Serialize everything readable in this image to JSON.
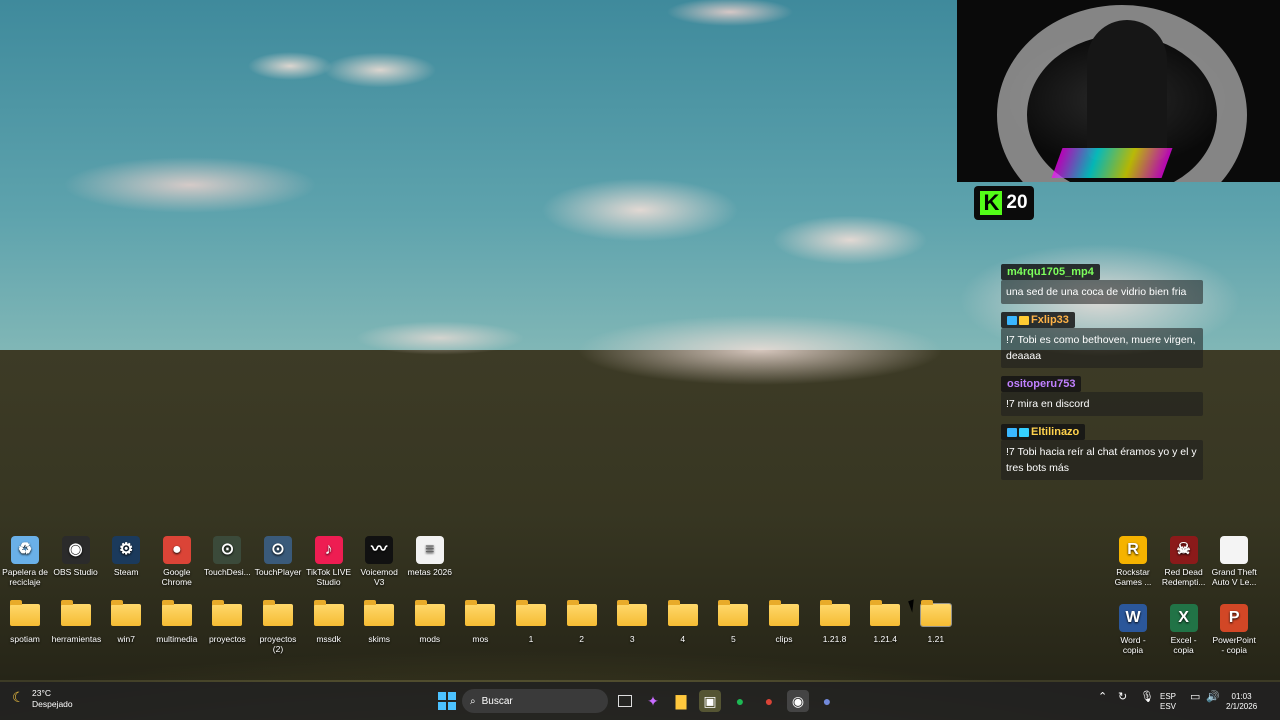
{
  "kick": {
    "count": "20",
    "logo": "K"
  },
  "chat": [
    {
      "user": "m4rqu1705_mp4",
      "user_color": "#7dff5c",
      "badges": [],
      "text": "una sed de una coca de vidrio bien fria"
    },
    {
      "user": "Fxlip33",
      "user_color": "#ffb347",
      "badges": [
        "#3ab7ff",
        "#ffcc33"
      ],
      "text": "!7 Tobi es como bethoven, muere virgen, deaaaa"
    },
    {
      "user": "ositoperu753",
      "user_color": "#c080ff",
      "badges": [],
      "text": "!7 mira en discord"
    },
    {
      "user": "Eltilinazo",
      "user_color": "#ffd24d",
      "badges": [
        "#3ab7ff",
        "#35d0ff"
      ],
      "text": "!7 Tobi hacia reír al chat éramos yo y el y tres bots más"
    }
  ],
  "desktop_top_row": [
    {
      "label": "Papelera de reciclaje",
      "icon": "recycle-bin-icon",
      "glyph": "♻",
      "color": "#6ab0e8"
    },
    {
      "label": "OBS Studio",
      "icon": "obs-icon",
      "glyph": "◉",
      "color": "#2b2b2b"
    },
    {
      "label": "Steam",
      "icon": "steam-icon",
      "glyph": "⚙",
      "color": "#1b3a5c"
    },
    {
      "label": "Google Chrome",
      "icon": "chrome-icon",
      "glyph": "●",
      "color": "#db4437"
    },
    {
      "label": "TouchDesi...",
      "icon": "touchdesigner-icon",
      "glyph": "⊙",
      "color": "#3b4a3a"
    },
    {
      "label": "TouchPlayer",
      "icon": "touchplayer-icon",
      "glyph": "⊙",
      "color": "#3a5a7a"
    },
    {
      "label": "TikTok LIVE Studio",
      "icon": "tiktok-icon",
      "glyph": "♪",
      "color": "#ee1d52"
    },
    {
      "label": "Voicemod V3",
      "icon": "voicemod-icon",
      "glyph": "〰",
      "color": "#111"
    },
    {
      "label": "metas 2026",
      "icon": "text-file-icon",
      "glyph": "≡",
      "color": "#f2f2f2"
    }
  ],
  "desktop_folders": [
    "spotiam",
    "herramientas",
    "win7",
    "multimedia",
    "proyectos",
    "proyectos (2)",
    "mssdk",
    "skims",
    "mods",
    "mos",
    "1",
    "2",
    "3",
    "4",
    "5",
    "clips",
    "1.21.8",
    "1.21.4",
    "1.21"
  ],
  "desktop_right_top": [
    {
      "label": "Rockstar Games ...",
      "icon": "rockstar-icon",
      "glyph": "R",
      "color": "#f5b300"
    },
    {
      "label": "Red Dead Redempti...",
      "icon": "red-dead-icon",
      "glyph": "☠",
      "color": "#8b1a1a"
    },
    {
      "label": "Grand Theft Auto V Le...",
      "icon": "file-icon",
      "glyph": "",
      "color": "#f4f4f4"
    }
  ],
  "desktop_right_bottom": [
    {
      "label": "Word - copia",
      "icon": "word-icon",
      "glyph": "W",
      "color": "#2b579a"
    },
    {
      "label": "Excel - copia",
      "icon": "excel-icon",
      "glyph": "X",
      "color": "#217346"
    },
    {
      "label": "PowerPoint - copia",
      "icon": "powerpoint-icon",
      "glyph": "P",
      "color": "#d24726"
    }
  ],
  "taskbar": {
    "weather_temp": "23°C",
    "weather_desc": "Despejado",
    "search_placeholder": "Buscar",
    "lang_top": "ESP",
    "lang_bottom": "ESV",
    "time": "01:03",
    "date": "2/1/2026"
  }
}
